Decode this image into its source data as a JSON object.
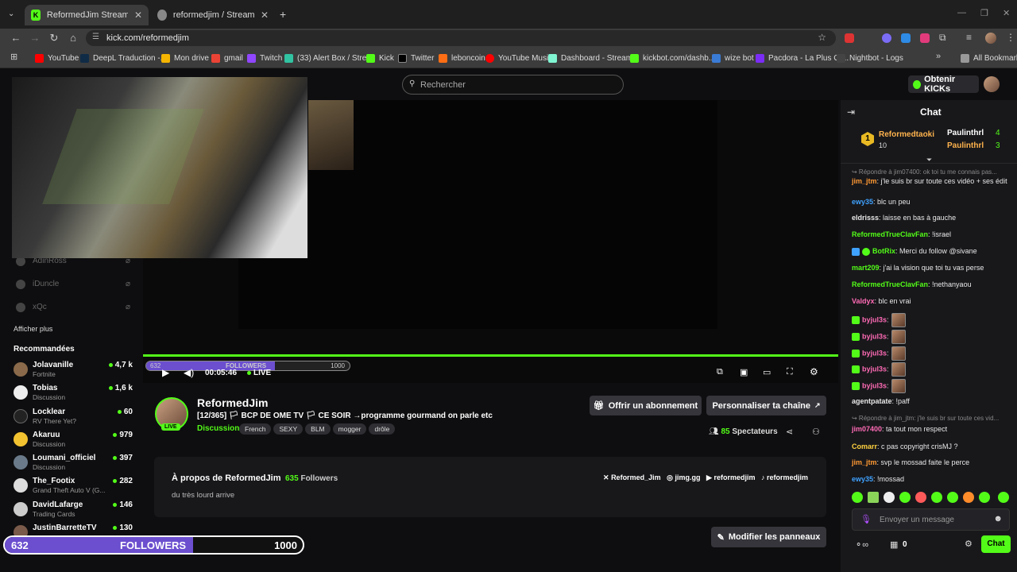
{
  "tabs": [
    {
      "title": "ReformedJim Stream - Watch L",
      "fav": "K"
    },
    {
      "title": "reformedjim / Streamlabs",
      "fav": ""
    }
  ],
  "url": "kick.com/reformedjim",
  "bookmarks": [
    "YouTube",
    "DeepL Traduction -...",
    "Mon drive",
    "gmail",
    "Twitch",
    "(33) Alert Box / Stre...",
    "Kick",
    "Twitter",
    "leboncoin",
    "YouTube Music",
    "Dashboard - Stream...",
    "kickbot.com/dashb...",
    "wize bot",
    "Pacdora - La Plus Gr...",
    "Nightbot - Logs",
    "All Bookmarks"
  ],
  "header": {
    "search_placeholder": "Rechercher",
    "kicks_label": "Obtenir KICKs"
  },
  "sidebar": {
    "offline": [
      "AdinRoss",
      "iDuncle",
      "xQc"
    ],
    "show_more": "Afficher plus",
    "recommended_title": "Recommandées",
    "recommended": [
      {
        "name": "Jolavanille",
        "cat": "Fortnite",
        "viewers": "4,7 k"
      },
      {
        "name": "Tobias",
        "cat": "Discussion",
        "viewers": "1,6 k"
      },
      {
        "name": "Locklear",
        "cat": "RV There Yet?",
        "viewers": "60"
      },
      {
        "name": "Akaruu",
        "cat": "Discussion",
        "viewers": "979"
      },
      {
        "name": "Loumani_officiel",
        "cat": "Discussion",
        "viewers": "397"
      },
      {
        "name": "The_Footix",
        "cat": "Grand Theft Auto V (G...",
        "viewers": "282"
      },
      {
        "name": "DavidLafarge",
        "cat": "Trading Cards",
        "viewers": "146"
      },
      {
        "name": "JustinBarretteTV",
        "cat": "",
        "viewers": "130"
      }
    ]
  },
  "player": {
    "time": "00:05:46",
    "live": "LIVE",
    "goal_current": "632",
    "goal_label": "FOLLOWERS",
    "goal_target": "1000",
    "goal_progress": 0.632
  },
  "channel": {
    "name": "ReformedJim",
    "title": "[12/365] 🏳 BCP DE OME TV 🏳 CE SOIR →programme gourmand on parle etc",
    "live_badge": "LIVE",
    "category": "Discussion",
    "tags": [
      "French",
      "SEXY",
      "BLM",
      "mogger",
      "drôle"
    ],
    "sub_button": "Offrir un abonnement",
    "customize_button": "Personnaliser ta chaîne",
    "viewers": "85",
    "viewers_label": "Spectateurs"
  },
  "about": {
    "title": "À propos de ReformedJim",
    "followers": "635",
    "followers_label": "Followers",
    "bio": "du très lourd arrive",
    "socials": [
      "Reformed_Jim",
      "jimg.gg",
      "reformedjim",
      "reformedjim"
    ],
    "edit_panels": "Modifier les panneaux"
  },
  "overlay": {
    "current": "632",
    "label": "FOLLOWERS",
    "target": "1000",
    "progress": 0.632
  },
  "chat": {
    "title": "Chat",
    "leaders": [
      {
        "rank": "1",
        "name": "Reformedtaoki",
        "value": "10"
      },
      {
        "name": "Paulinthrl",
        "value": "4"
      },
      {
        "name": "Paulinthrl",
        "value": "3"
      }
    ],
    "messages": [
      {
        "reply": "↪ Répondre à jim07400: ok toi tu me connais pas..."
      },
      {
        "user": "jim_jtm",
        "color": "#ff9933",
        "text": ": j'le suis br sur toute ces vidéo + ses édit"
      },
      {
        "user": "ewy35",
        "color": "#3fa2ff",
        "text": ": blc un peu"
      },
      {
        "user": "eldrisss",
        "color": "#e8e8e8",
        "text": ": laisse en bas à gauche"
      },
      {
        "user": "ReformedTrueClavFan",
        "color": "#53fc18",
        "text": ": !israel"
      },
      {
        "user": "BotRix",
        "color": "#53fc18",
        "text": ": Merci du follow @sivane"
      },
      {
        "user": "mart209",
        "color": "#53fc18",
        "text": ": j'ai la vision que toi tu vas perse"
      },
      {
        "user": "ReformedTrueClavFan",
        "color": "#53fc18",
        "text": ": !nethanyaou"
      },
      {
        "user": "Valdyx",
        "color": "#ff6bb5",
        "text": ": blc en vrai"
      },
      {
        "user": "byjul3s",
        "color": "#ff6bb5",
        "text": ":"
      },
      {
        "user": "byjul3s",
        "color": "#ff6bb5",
        "text": ":"
      },
      {
        "user": "byjul3s",
        "color": "#ff6bb5",
        "text": ":"
      },
      {
        "user": "byjul3s",
        "color": "#ff6bb5",
        "text": ":"
      },
      {
        "user": "byjul3s",
        "color": "#ff6bb5",
        "text": ":"
      },
      {
        "user": "agentpatate",
        "color": "#e8e8e8",
        "text": ": !paff"
      },
      {
        "reply": "↪ Répondre à jim_jtm: j'le suis br sur toute ces vid..."
      },
      {
        "user": "jim07400",
        "color": "#ff6bb5",
        "text": ": ta tout mon respect"
      },
      {
        "user": "Comarr",
        "color": "#ffd23f",
        "text": ": c pas copyright crisMJ ?"
      },
      {
        "user": "jim_jtm",
        "color": "#ff9933",
        "text": ": svp le mossad faite le perce"
      },
      {
        "user": "ewy35",
        "color": "#3fa2ff",
        "text": ": !mossad"
      }
    ],
    "input_placeholder": "Envoyer un message",
    "kicks_count": "0",
    "send_label": "Chat"
  },
  "colors": {
    "accent": "#53fc18",
    "overlay_purple": "#6b4fcf"
  }
}
